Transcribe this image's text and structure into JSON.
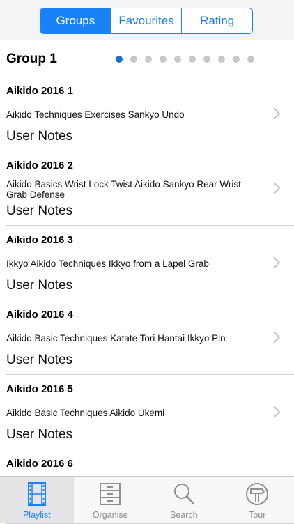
{
  "segmented_control": {
    "items": [
      {
        "label": "Groups",
        "active": true
      },
      {
        "label": "Favourites",
        "active": false
      },
      {
        "label": "Rating",
        "active": false
      }
    ]
  },
  "group": {
    "title": "Group 1",
    "page_count": 10,
    "current_page": 1
  },
  "playlists": [
    {
      "title": "Aikido 2016 1",
      "description": "Aikido Techniques  Exercises  Sankyo Undo",
      "notes": "User Notes"
    },
    {
      "title": "Aikido 2016 2",
      "description": "Aikido Basics Wrist Lock Twist  Aikido Sankyo Rear Wrist Grab Defense",
      "notes": "User Notes"
    },
    {
      "title": "Aikido 2016 3",
      "description": "Ikkyo Aikido Techniques  Ikkyo from a Lapel Grab",
      "notes": "User Notes"
    },
    {
      "title": "Aikido 2016 4",
      "description": "Aikido Basic Techniques  Katate Tori Hantai Ikkyo Pin",
      "notes": "User Notes"
    },
    {
      "title": "Aikido 2016 5",
      "description": "Aikido Basic Techniques  Aikido Ukemi",
      "notes": "User Notes"
    },
    {
      "title": "Aikido 2016 6",
      "description": "",
      "notes": ""
    }
  ],
  "tabbar": {
    "items": [
      {
        "label": "Playlist",
        "icon": "film-icon",
        "active": true
      },
      {
        "label": "Organise",
        "icon": "cabinet-icon",
        "active": false
      },
      {
        "label": "Search",
        "icon": "magnifier-icon",
        "active": false
      },
      {
        "label": "Tour",
        "icon": "signpost-icon",
        "active": false
      }
    ]
  },
  "colors": {
    "accent": "#1a82f7",
    "inactive": "#8e8e93",
    "dot_active": "#1a6fd1",
    "dot_inactive": "#c8c8c8"
  }
}
